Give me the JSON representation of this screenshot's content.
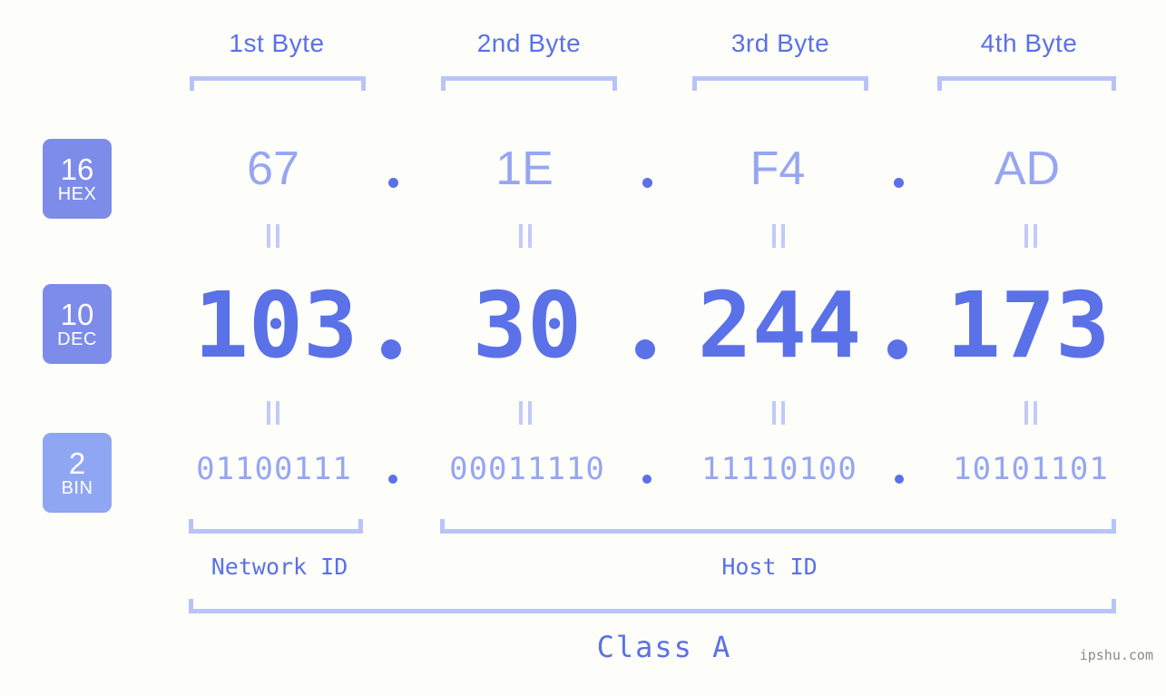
{
  "ip": {
    "decimal": "103.30.244.173",
    "hex": "67.1E.F4.AD",
    "binary": "01100111.00011110.11110100.10101101"
  },
  "byte_headers": [
    {
      "label": "1st Byte"
    },
    {
      "label": "2nd Byte"
    },
    {
      "label": "3rd Byte"
    },
    {
      "label": "4th Byte"
    }
  ],
  "rows": {
    "hex": {
      "base": "16",
      "system": "HEX",
      "values": [
        "67",
        "1E",
        "F4",
        "AD"
      ]
    },
    "dec": {
      "base": "10",
      "system": "DEC",
      "values": [
        "103",
        "30",
        "244",
        "173"
      ]
    },
    "bin": {
      "base": "2",
      "system": "BIN",
      "values": [
        "01100111",
        "00011110",
        "11110100",
        "10101101"
      ]
    }
  },
  "separators": {
    "dot": ".",
    "equals": "="
  },
  "segments": {
    "network_id": "Network ID",
    "host_id": "Host ID",
    "class": "Class A"
  },
  "watermark": "ipshu.com",
  "colors": {
    "background": "#fdfdfa",
    "accent_strong": "#5a71e8",
    "accent_light": "#97a6f2",
    "bracket": "#b9c3f8",
    "badge_hex": "#7d8ce9",
    "badge_dec": "#7d8ce9",
    "badge_bin": "#8fa6f2",
    "watermark": "#8a8a8a"
  }
}
